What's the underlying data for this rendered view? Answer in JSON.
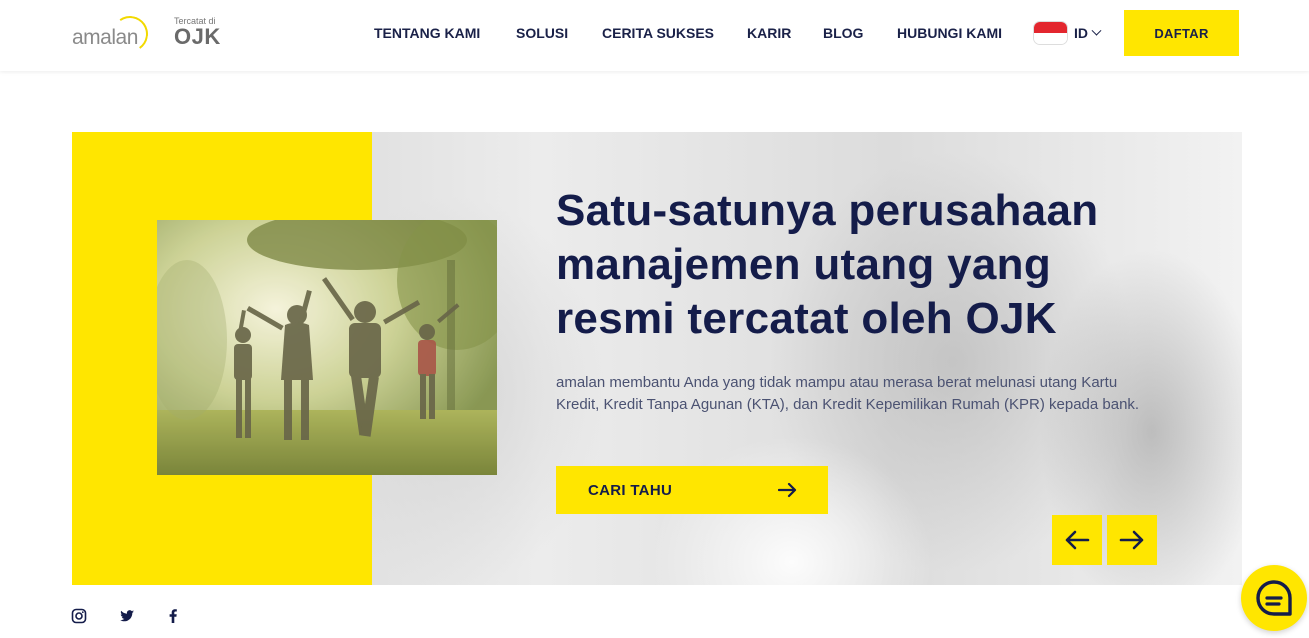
{
  "header": {
    "logo_text": "amalan",
    "ojk_small": "Tercatat di",
    "ojk_big": "OJK",
    "nav": [
      {
        "label": "TENTANG KAMI"
      },
      {
        "label": "SOLUSI"
      },
      {
        "label": "CERITA SUKSES"
      },
      {
        "label": "KARIR"
      },
      {
        "label": "BLOG"
      },
      {
        "label": "HUBUNGI KAMI"
      }
    ],
    "language": "ID",
    "daftar_label": "DAFTAR"
  },
  "hero": {
    "title": "Satu-satunya perusahaan manajemen utang yang resmi tercatat oleh OJK",
    "description": "amalan membantu Anda yang tidak mampu atau merasa berat melunasi utang Kartu Kredit, Kredit Tanpa Agunan (KTA), dan Kredit Kepemilikan Rumah (KPR) kepada bank.",
    "cta_label": "CARI TAHU"
  },
  "colors": {
    "brand_yellow": "#ffe600",
    "navy": "#141c4a",
    "text_gray": "#4b5272"
  },
  "icons": {
    "social": [
      "instagram-icon",
      "twitter-icon",
      "facebook-icon"
    ],
    "carousel": [
      "arrow-left-icon",
      "arrow-right-icon"
    ],
    "chat": "chat-icon"
  }
}
